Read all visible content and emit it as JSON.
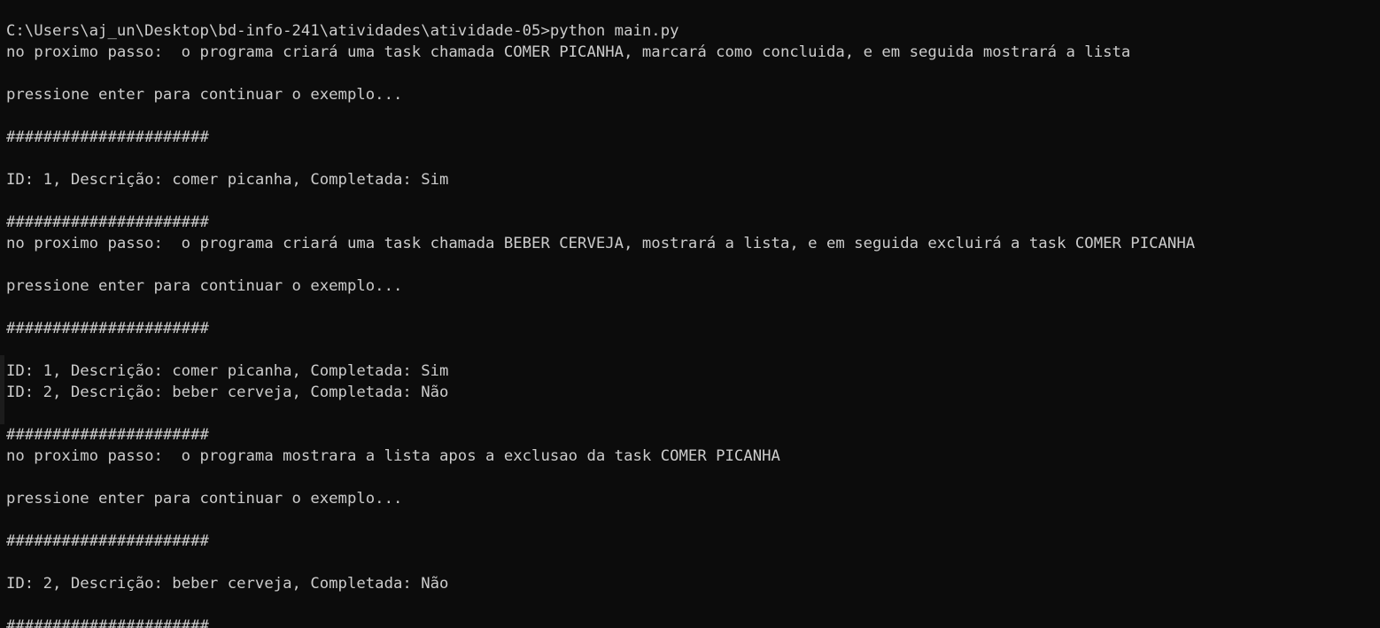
{
  "terminal": {
    "lines": [
      "C:\\Users\\aj_un\\Desktop\\bd-info-241\\atividades\\atividade-05>python main.py",
      "no proximo passo:  o programa criará uma task chamada COMER PICANHA, marcará como concluida, e em seguida mostrará a lista",
      "",
      "pressione enter para continuar o exemplo...",
      "",
      "######################",
      "",
      "ID: 1, Descrição: comer picanha, Completada: Sim",
      "",
      "######################",
      "no proximo passo:  o programa criará uma task chamada BEBER CERVEJA, mostrará a lista, e em seguida excluirá a task COMER PICANHA",
      "",
      "pressione enter para continuar o exemplo...",
      "",
      "######################",
      "",
      "ID: 1, Descrição: comer picanha, Completada: Sim",
      "ID: 2, Descrição: beber cerveja, Completada: Não",
      "",
      "######################",
      "no proximo passo:  o programa mostrara a lista apos a exclusao da task COMER PICANHA",
      "",
      "pressione enter para continuar o exemplo...",
      "",
      "######################",
      "",
      "ID: 2, Descrição: beber cerveja, Completada: Não",
      "",
      "######################"
    ],
    "colors": {
      "background": "#0c0c0c",
      "foreground": "#cccccc"
    }
  }
}
